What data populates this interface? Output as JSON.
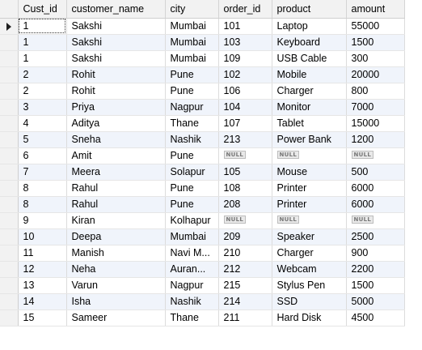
{
  "grid": {
    "columns": [
      "Cust_id",
      "customer_name",
      "city",
      "order_id",
      "product",
      "amount"
    ],
    "null_label": "NULL",
    "rows": [
      [
        "1",
        "Sakshi",
        "Mumbai",
        "101",
        "Laptop",
        "55000"
      ],
      [
        "1",
        "Sakshi",
        "Mumbai",
        "103",
        "Keyboard",
        "1500"
      ],
      [
        "1",
        "Sakshi",
        "Mumbai",
        "109",
        "USB Cable",
        "300"
      ],
      [
        "2",
        "Rohit",
        "Pune",
        "102",
        "Mobile",
        "20000"
      ],
      [
        "2",
        "Rohit",
        "Pune",
        "106",
        "Charger",
        "800"
      ],
      [
        "3",
        "Priya",
        "Nagpur",
        "104",
        "Monitor",
        "7000"
      ],
      [
        "4",
        "Aditya",
        "Thane",
        "107",
        "Tablet",
        "15000"
      ],
      [
        "5",
        "Sneha",
        "Nashik",
        "213",
        "Power Bank",
        "1200"
      ],
      [
        "6",
        "Amit",
        "Pune",
        null,
        null,
        null
      ],
      [
        "7",
        "Meera",
        "Solapur",
        "105",
        "Mouse",
        "500"
      ],
      [
        "8",
        "Rahul",
        "Pune",
        "108",
        "Printer",
        "6000"
      ],
      [
        "8",
        "Rahul",
        "Pune",
        "208",
        "Printer",
        "6000"
      ],
      [
        "9",
        "Kiran",
        "Kolhapur",
        null,
        null,
        null
      ],
      [
        "10",
        "Deepa",
        "Mumbai",
        "209",
        "Speaker",
        "2500"
      ],
      [
        "11",
        "Manish",
        "Navi M...",
        "210",
        "Charger",
        "900"
      ],
      [
        "12",
        "Neha",
        "Auran...",
        "212",
        "Webcam",
        "2200"
      ],
      [
        "13",
        "Varun",
        "Nagpur",
        "215",
        "Stylus Pen",
        "1500"
      ],
      [
        "14",
        "Isha",
        "Nashik",
        "214",
        "SSD",
        "5000"
      ],
      [
        "15",
        "Sameer",
        "Thane",
        "211",
        "Hard Disk",
        "4500"
      ]
    ]
  },
  "selection": {
    "row": 0,
    "col": 0
  },
  "icons": {
    "current_row": "current-row-caret-icon"
  }
}
